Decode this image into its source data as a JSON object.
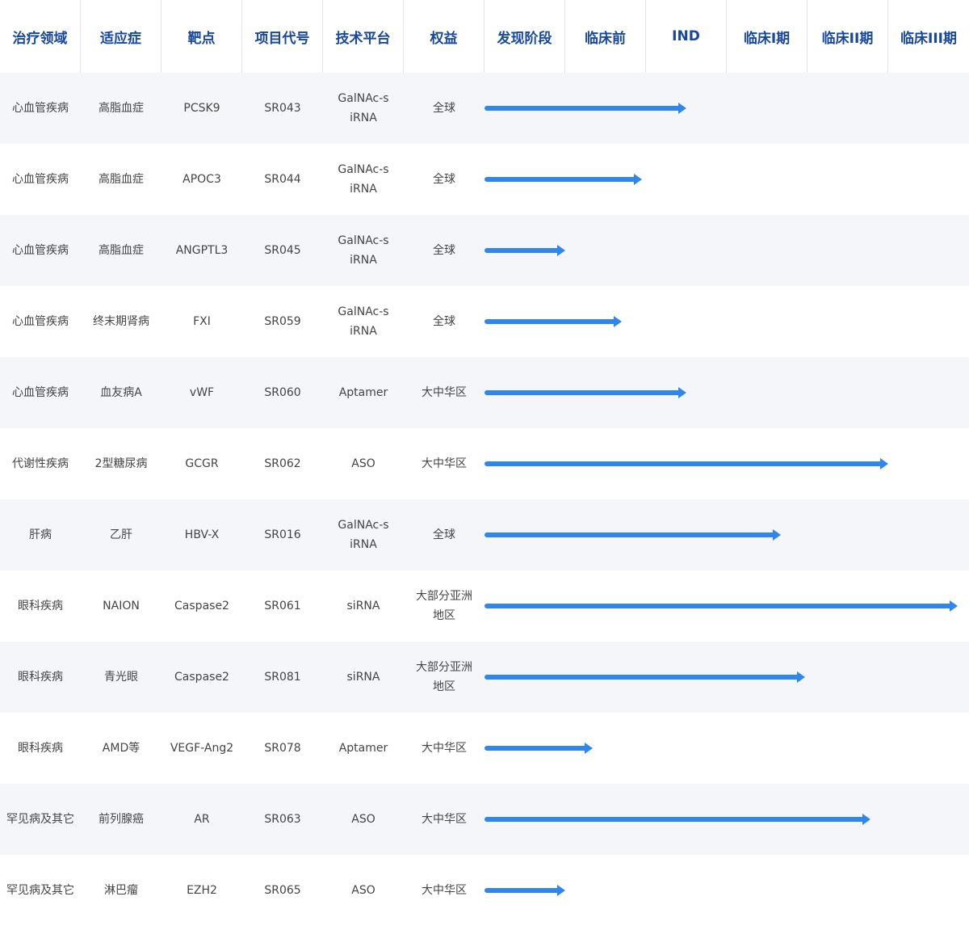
{
  "header": {
    "columns": [
      "治疗领域",
      "适应症",
      "靶点",
      "项目代号",
      "技术平台",
      "权益",
      "发现阶段",
      "临床前",
      "IND",
      "临床I期",
      "临床II期",
      "临床III期"
    ]
  },
  "colors": {
    "accent": "#17479e",
    "progress_bar": "#2f86ee",
    "row_shade": "#f4f6f9"
  },
  "rows": [
    {
      "area": "心血管疾病",
      "indication": "高脂血症",
      "target": "PCSK9",
      "code": "SR043",
      "platform": "GalNAc-siRNA",
      "rights": "全球",
      "progress": 0.417
    },
    {
      "area": "心血管疾病",
      "indication": "高脂血症",
      "target": "APOC3",
      "code": "SR044",
      "platform": "GalNAc-siRNA",
      "rights": "全球",
      "progress": 0.325
    },
    {
      "area": "心血管疾病",
      "indication": "高脂血症",
      "target": "ANGPTL3",
      "code": "SR045",
      "platform": "GalNAc-siRNA",
      "rights": "全球",
      "progress": 0.167
    },
    {
      "area": "心血管疾病",
      "indication": "终末期肾病",
      "target": "FXI",
      "code": "SR059",
      "platform": "GalNAc-siRNA",
      "rights": "全球",
      "progress": 0.283
    },
    {
      "area": "心血管疾病",
      "indication": "血友病A",
      "target": "vWF",
      "code": "SR060",
      "platform": "Aptamer",
      "rights": "大中华区",
      "progress": 0.417
    },
    {
      "area": "代谢性疾病",
      "indication": "2型糖尿病",
      "target": "GCGR",
      "code": "SR062",
      "platform": "ASO",
      "rights": "大中华区",
      "progress": 0.833
    },
    {
      "area": "肝病",
      "indication": "乙肝",
      "target": "HBV-X",
      "code": "SR016",
      "platform": "GalNAc-siRNA",
      "rights": "全球",
      "progress": 0.612
    },
    {
      "area": "眼科疾病",
      "indication": "NAION",
      "target": "Caspase2",
      "code": "SR061",
      "platform": "siRNA",
      "rights": "大部分亚洲地区",
      "progress": 0.977
    },
    {
      "area": "眼科疾病",
      "indication": "青光眼",
      "target": "Caspase2",
      "code": "SR081",
      "platform": "siRNA",
      "rights": "大部分亚洲地区",
      "progress": 0.662
    },
    {
      "area": "眼科疾病",
      "indication": "AMD等",
      "target": "VEGF-Ang2",
      "code": "SR078",
      "platform": "Aptamer",
      "rights": "大中华区",
      "progress": 0.223
    },
    {
      "area": "罕见病及其它",
      "indication": "前列腺癌",
      "target": "AR",
      "code": "SR063",
      "platform": "ASO",
      "rights": "大中华区",
      "progress": 0.797
    },
    {
      "area": "罕见病及其它",
      "indication": "淋巴瘤",
      "target": "EZH2",
      "code": "SR065",
      "platform": "ASO",
      "rights": "大中华区",
      "progress": 0.167
    }
  ]
}
